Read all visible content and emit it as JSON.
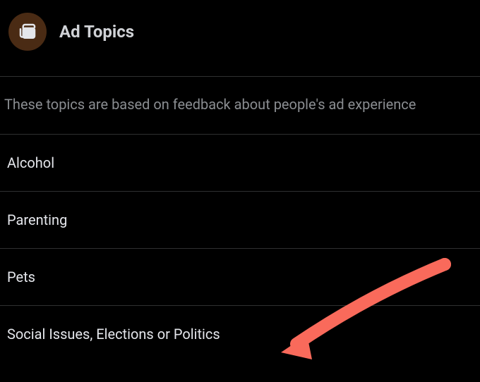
{
  "header": {
    "title": "Ad Topics",
    "icon": "topics-icon"
  },
  "description": "These topics are based on feedback about people's ad experience",
  "topics": {
    "items": [
      {
        "label": "Alcohol"
      },
      {
        "label": "Parenting"
      },
      {
        "label": "Pets"
      },
      {
        "label": "Social Issues, Elections or Politics"
      }
    ]
  },
  "annotation": {
    "color": "#f96a5b"
  }
}
